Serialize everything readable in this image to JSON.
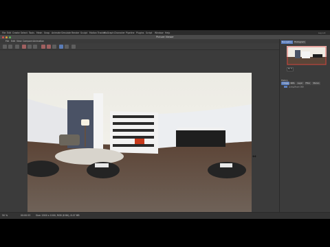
{
  "menubar": {
    "items": [
      "File",
      "Edit",
      "Create",
      "Select",
      "Tools",
      "Mesh",
      "Snap",
      "Animate",
      "Simulate",
      "Render",
      "Sculpt",
      "Motion Tracker",
      "MoGraph",
      "Character",
      "Pipeline",
      "Plugins",
      "Script",
      "Window",
      "Help"
    ],
    "right_text": "Layout:"
  },
  "window": {
    "title": "Picture Viewer"
  },
  "submenu": {
    "items": [
      "File",
      "Edit",
      "View",
      "Compare",
      "Animation"
    ]
  },
  "right_panel": {
    "tabs": [
      "Navigator",
      "Histogram"
    ],
    "zoom": "50 %",
    "sub_tabs": [
      "Image",
      "Info",
      "Layer",
      "Filter",
      "Stereo"
    ],
    "section_title": "History",
    "rows": [
      "Image Info",
      "Living Room 360"
    ]
  },
  "statusbar": {
    "zoom": "50 %",
    "time": "00:00:53",
    "info": "Size: 2000 x 1000, RGB (8 Bit), 8.07 MB"
  },
  "colors": {
    "accent": "#5b7fc0",
    "wall_accent": "#4a5265",
    "floor": "#4a3a30",
    "bookshelf": "#f2f2f2",
    "fireplace": "#c83a1c"
  }
}
